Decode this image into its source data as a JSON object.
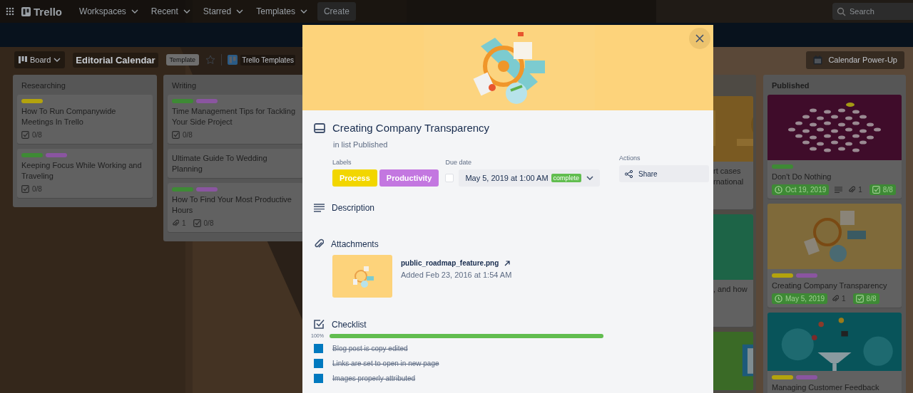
{
  "topbar": {
    "logo": "Trello",
    "menus": [
      {
        "label": "Workspaces"
      },
      {
        "label": "Recent"
      },
      {
        "label": "Starred"
      },
      {
        "label": "Templates"
      }
    ],
    "create": "Create",
    "search": {
      "placeholder": "Search"
    }
  },
  "board_header": {
    "view": "Board",
    "title": "Editorial Calendar",
    "badge": "Template",
    "starred": false,
    "workspace": "Trello Templates",
    "power_up": "Calendar Power-Up"
  },
  "lists": [
    {
      "kind": "full",
      "title": "Researching",
      "cards": [
        {
          "labels": [
            {
              "color": "#b3a30d"
            }
          ],
          "title": "How To Run Companywide Meetings In Trello",
          "badges": [
            {
              "kind": "checklist",
              "text": "0/8",
              "complete": false
            }
          ]
        },
        {
          "labels": [
            {
              "color": "#3e8a35"
            },
            {
              "color": "#8a55a0"
            }
          ],
          "title": "Keeping Focus While Working and Traveling",
          "badges": [
            {
              "kind": "checklist",
              "text": "0/8",
              "complete": false
            }
          ]
        }
      ]
    },
    {
      "kind": "full",
      "title": "Writing",
      "cards": [
        {
          "labels": [
            {
              "color": "#3e8a35"
            },
            {
              "color": "#8a55a0"
            }
          ],
          "title": "Time Management Tips for Tackling Your Side Project",
          "badges": [
            {
              "kind": "checklist",
              "text": "0/8",
              "complete": false
            }
          ]
        },
        {
          "title": "Ultimate Guide To Wedding Planning"
        },
        {
          "labels": [
            {
              "color": "#3e8a35"
            },
            {
              "color": "#8a55a0"
            }
          ],
          "title": "How To Find Your Most Productive Hours",
          "badges": [
            {
              "kind": "attachments",
              "text": "1"
            },
            {
              "kind": "checklist",
              "text": "0/8",
              "complete": false
            }
          ]
        }
      ]
    },
    {
      "kind": "partial",
      "cards": [
        {
          "cover": {
            "kind": "picture"
          },
          "lines": [
            "rt cases",
            "rnational"
          ]
        },
        {
          "cover": {
            "kind": "picture"
          },
          "lines": [
            ", and how"
          ]
        },
        {
          "cover": {
            "kind": "picture"
          }
        }
      ]
    },
    {
      "kind": "full",
      "title": "Published",
      "cards": [
        {
          "cover": {
            "kind": "picture"
          },
          "labels": [
            {
              "color": "#3e8a35"
            }
          ],
          "title": "Don't Do Nothing",
          "badges": [
            {
              "kind": "due",
              "text": "Oct 19, 2019",
              "complete": true
            },
            {
              "kind": "description"
            },
            {
              "kind": "attachments",
              "text": "1"
            },
            {
              "kind": "checklist",
              "text": "8/8",
              "complete": true
            }
          ]
        },
        {
          "cover": {
            "kind": "picture"
          },
          "labels": [
            {
              "color": "#b3a30d"
            },
            {
              "color": "#8a55a0"
            }
          ],
          "title": "Creating Company Transparency",
          "badges": [
            {
              "kind": "due",
              "text": "May 5, 2019",
              "complete": true
            },
            {
              "kind": "attachments",
              "text": "1"
            },
            {
              "kind": "checklist",
              "text": "8/8",
              "complete": true
            }
          ]
        },
        {
          "cover": {
            "kind": "picture"
          },
          "labels": [
            {
              "color": "#b3a30d"
            },
            {
              "color": "#8a55a0"
            }
          ],
          "title": "Managing Customer Feedback"
        }
      ]
    }
  ],
  "card_modal": {
    "cover": {
      "kind": "picture"
    },
    "title": "Creating Company Transparency",
    "list_line": "in list Published",
    "labels_heading": "Labels",
    "labels": [
      {
        "text": "Process",
        "color": "#f2d600"
      },
      {
        "text": "Productivity",
        "color": "#c377e0"
      }
    ],
    "due_heading": "Due date",
    "due": {
      "checked": false,
      "text": "May 5, 2019 at 1:00 AM",
      "status": "complete"
    },
    "actions_heading": "Actions",
    "actions": [
      {
        "kind": "share",
        "label": "Share"
      }
    ],
    "description_heading": "Description",
    "attachments_heading": "Attachments",
    "attachments": [
      {
        "name": "public_roadmap_feature.png",
        "added": "Added Feb 23, 2016 at 1:54 AM"
      }
    ],
    "checklist_heading": "Checklist",
    "checklist_percent": "100%",
    "level": 1,
    "checklist_items": [
      {
        "text": "Blog post is copy edited",
        "checked": true
      },
      {
        "text": "Links are set to open in new page",
        "checked": true
      },
      {
        "text": "Images properly attributed",
        "checked": true
      }
    ]
  }
}
